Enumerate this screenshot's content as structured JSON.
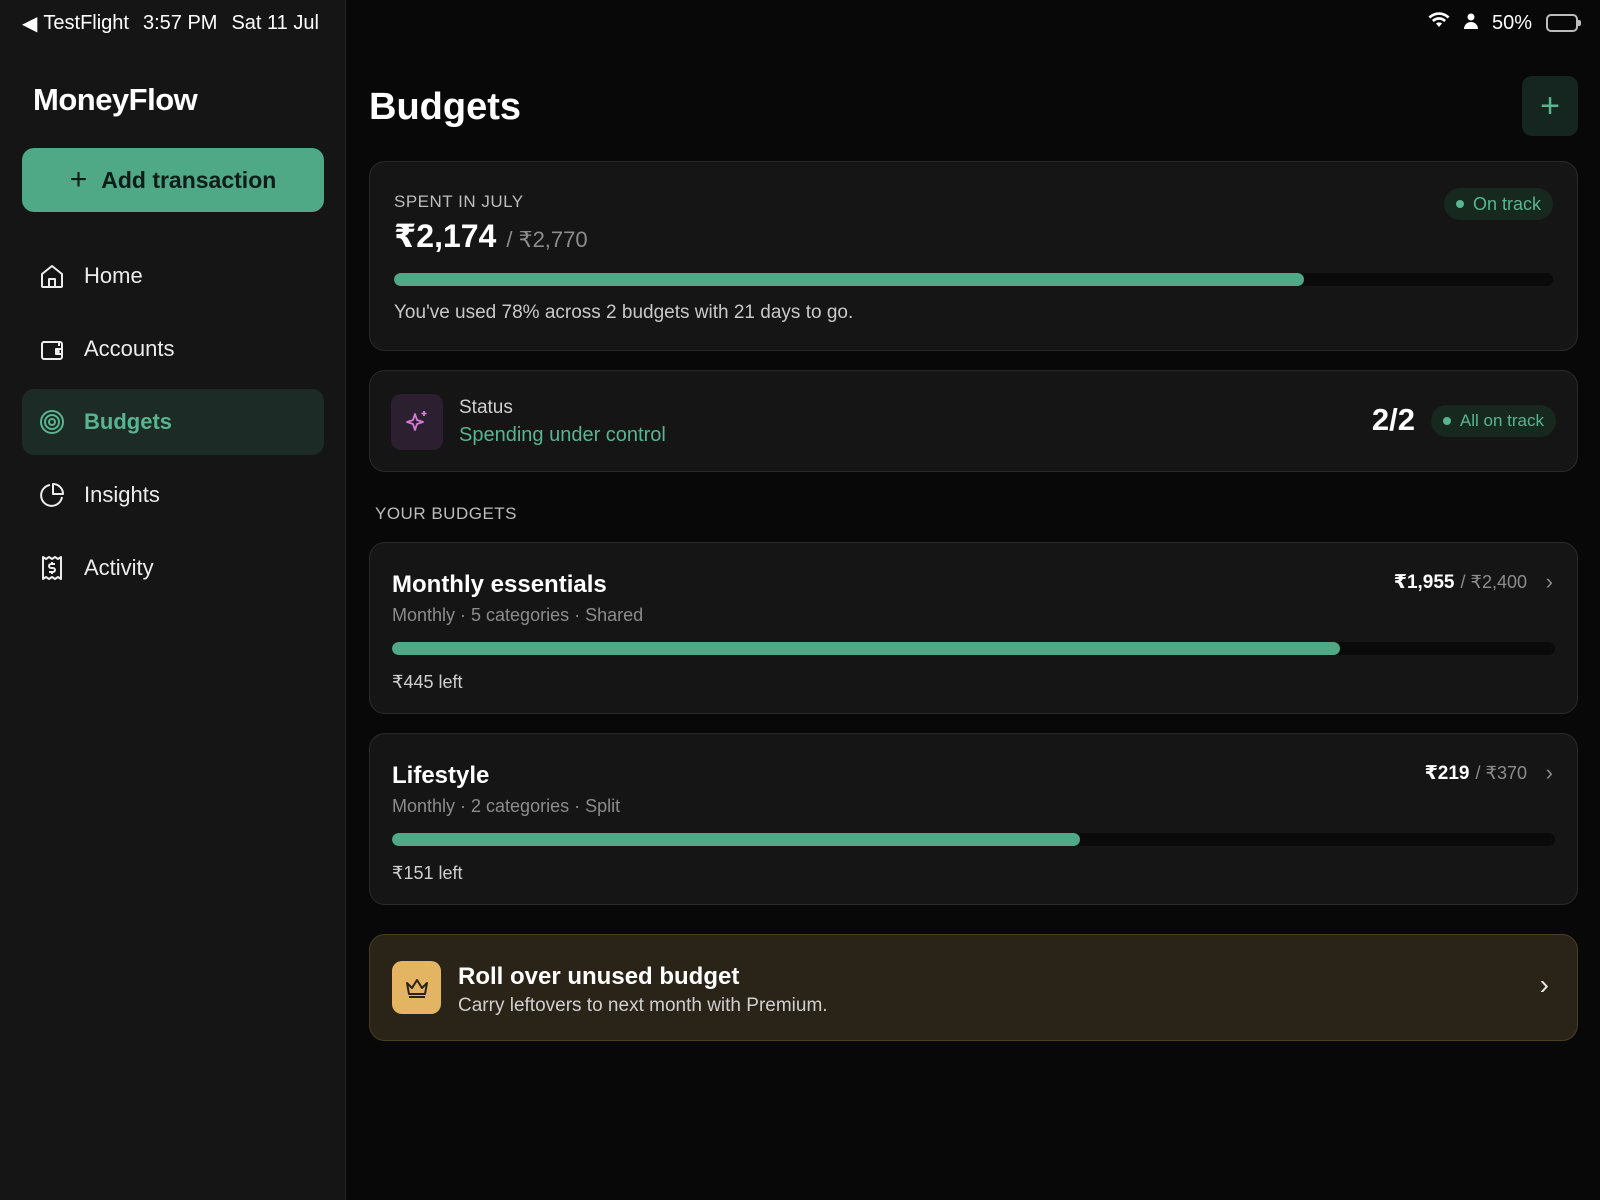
{
  "status_bar": {
    "back_app": "TestFlight",
    "time": "3:57 PM",
    "date": "Sat 11 Jul",
    "battery": "50%",
    "battery_level": 0.5
  },
  "sidebar": {
    "brand": "MoneyFlow",
    "add_button": "Add transaction",
    "items": [
      {
        "label": "Home",
        "icon": "home-icon",
        "active": false
      },
      {
        "label": "Accounts",
        "icon": "wallet-icon",
        "active": false
      },
      {
        "label": "Budgets",
        "icon": "target-icon",
        "active": true
      },
      {
        "label": "Insights",
        "icon": "pie-chart-icon",
        "active": false
      },
      {
        "label": "Activity",
        "icon": "receipt-icon",
        "active": false
      }
    ]
  },
  "main": {
    "title": "Budgets",
    "summary": {
      "label": "SPENT IN JULY",
      "spent": "₹2,174",
      "total": "/ ₹2,770",
      "badge": "On track",
      "progress": 0.785,
      "note": "You've used 78% across 2 budgets with 21 days to go."
    },
    "status": {
      "title": "Status",
      "subtitle": "Spending under control",
      "count": "2/2",
      "badge": "All on track"
    },
    "section_label": "YOUR BUDGETS",
    "budgets": [
      {
        "name": "Monthly essentials",
        "meta": "Monthly · 5 categories · Shared",
        "used": "₹1,955",
        "limit": "/ ₹2,400",
        "progress": 0.815,
        "left": "₹445 left"
      },
      {
        "name": "Lifestyle",
        "meta": "Monthly · 2 categories · Split",
        "used": "₹219",
        "limit": "/ ₹370",
        "progress": 0.592,
        "left": "₹151 left"
      }
    ],
    "promo": {
      "title": "Roll over unused budget",
      "subtitle": "Carry leftovers to next month with Premium."
    }
  },
  "colors": {
    "accent": "#4fa886",
    "accent_text": "#58b58f",
    "background": "#080808",
    "card": "#151515",
    "premium": "#e3b562"
  }
}
